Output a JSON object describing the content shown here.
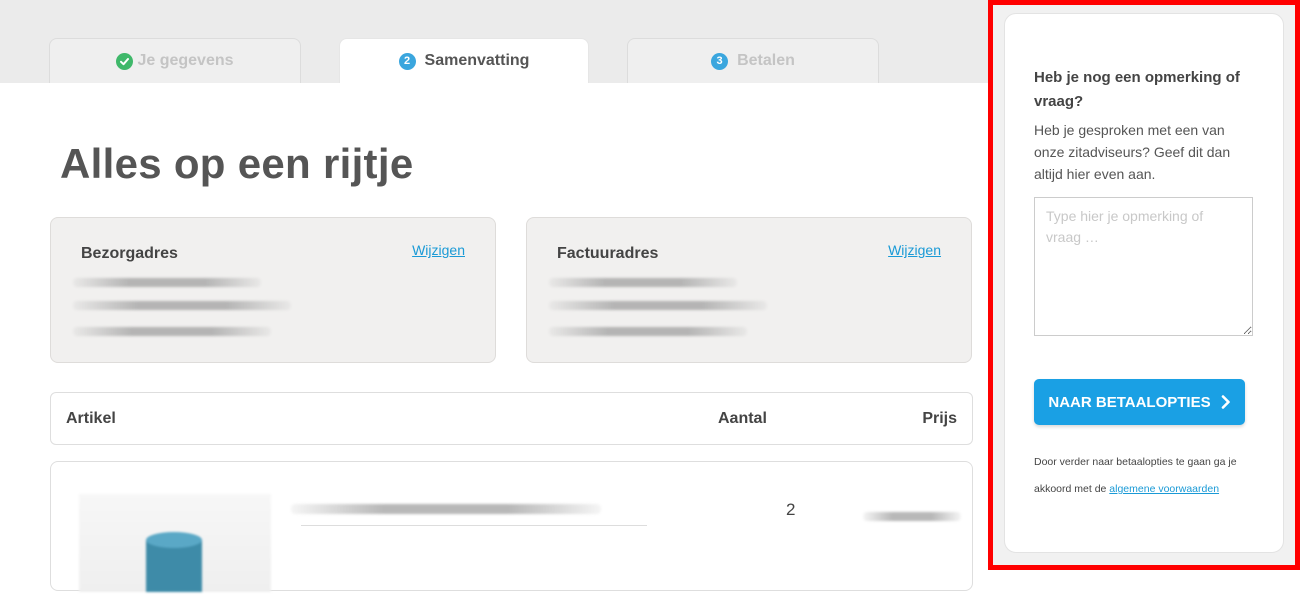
{
  "tabs": [
    {
      "label": "Je gegevens",
      "state": "done"
    },
    {
      "number": "2",
      "label": "Samenvatting",
      "state": "active"
    },
    {
      "number": "3",
      "label": "Betalen",
      "state": "upcoming"
    }
  ],
  "heading": "Alles op een rijtje",
  "addresses": {
    "delivery": {
      "title": "Bezorgadres",
      "edit_link": "Wijzigen"
    },
    "invoice": {
      "title": "Factuuradres",
      "edit_link": "Wijzigen"
    }
  },
  "table": {
    "columns": [
      "Artikel",
      "Aantal",
      "Prijs"
    ],
    "rows": [
      {
        "quantity": "2"
      }
    ]
  },
  "sidebar": {
    "question_title": "Heb je nog een opmerking of vraag?",
    "question_text": "Heb je gesproken met een van onze zitadviseurs? Geef dit dan altijd hier even aan.",
    "remark_placeholder": "Type hier je opmerking of vraag …",
    "cta_label": "NAAR BETAALOPTIES",
    "legal_text": "Door verder naar betaalopties te gaan ga je akkoord met de",
    "legal_link": "algemene voorwaarden"
  },
  "colors": {
    "accent": "#1aa0e4",
    "check": "#3fb86a",
    "highlight_border": "#ff0000"
  }
}
